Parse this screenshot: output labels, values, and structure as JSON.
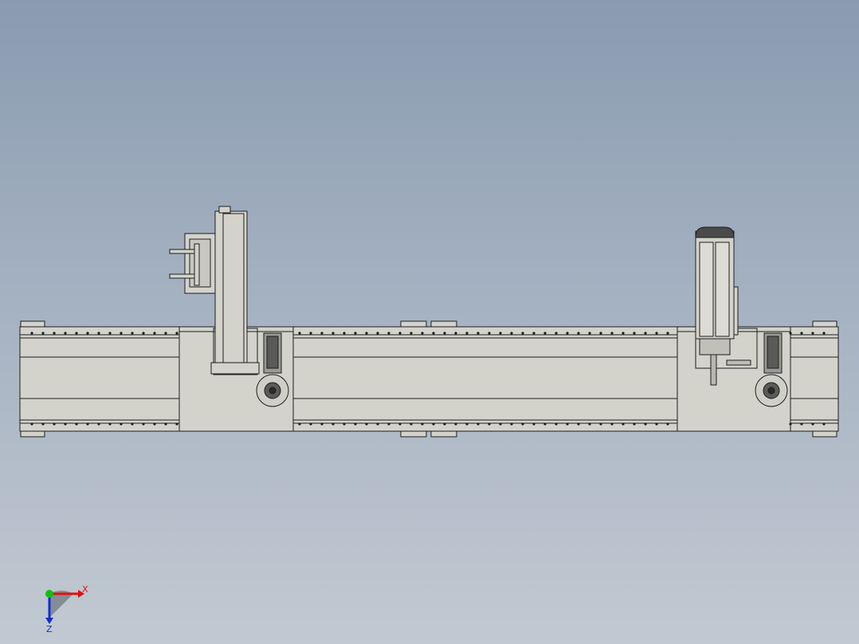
{
  "viewport": {
    "background_top": "#8a9bb0",
    "background_bottom": "#c2c9d2",
    "model_fill": "#d3d3cc",
    "model_stroke": "#1e1e1e"
  },
  "triad": {
    "x_label": "X",
    "z_label": "Z",
    "x_color": "#e01010",
    "y_color": "#10c010",
    "z_color": "#1030d0"
  }
}
